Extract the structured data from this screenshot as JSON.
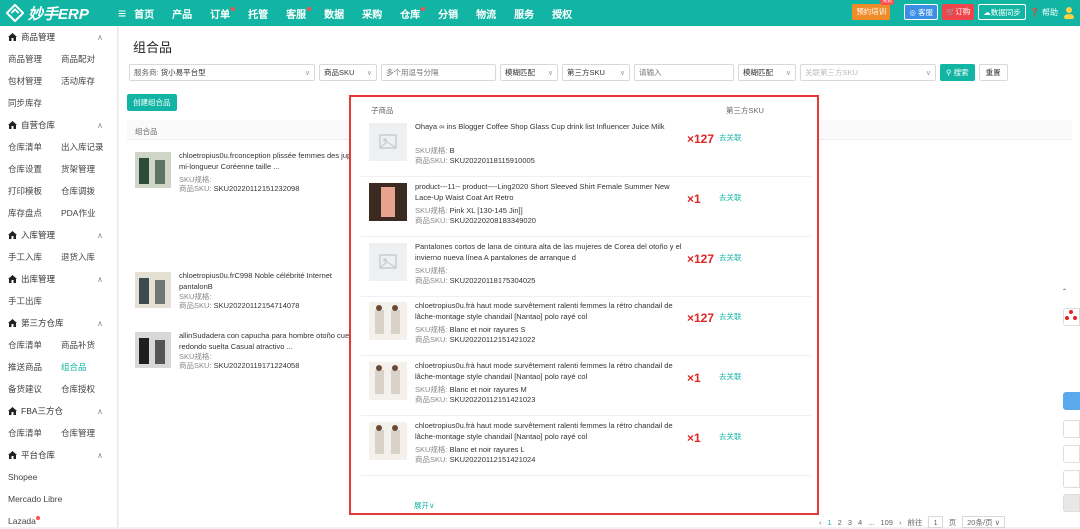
{
  "app": {
    "logo_text": "妙手ERP"
  },
  "topnav": {
    "items": [
      {
        "label": "首页",
        "dot": false
      },
      {
        "label": "产品",
        "dot": false
      },
      {
        "label": "订单",
        "dot": true
      },
      {
        "label": "托管",
        "dot": false
      },
      {
        "label": "客服",
        "dot": true
      },
      {
        "label": "数据",
        "dot": false
      },
      {
        "label": "采购",
        "dot": false
      },
      {
        "label": "仓库",
        "dot": true
      },
      {
        "label": "分销",
        "dot": false
      },
      {
        "label": "物流",
        "dot": false
      },
      {
        "label": "服务",
        "dot": false
      },
      {
        "label": "授权",
        "dot": false
      }
    ],
    "right": {
      "training": "预约培训",
      "training_badge": "免费",
      "service": "客服",
      "order": "订购",
      "sync": "数据同步",
      "help": "帮助"
    }
  },
  "sidebar": {
    "goods": {
      "title": "商品管理",
      "items": [
        "商品管理",
        "商品配对",
        "包材管理",
        "活动库存"
      ],
      "extra": "同步库存"
    },
    "self_wh": {
      "title": "自营仓库",
      "items": [
        "仓库清单",
        "出入库记录",
        "仓库设置",
        "货架管理",
        "打印模板",
        "仓库调拨",
        "库存盘点",
        "PDA作业"
      ]
    },
    "inbound": {
      "title": "入库管理",
      "items": [
        "手工入库",
        "退货入库"
      ]
    },
    "outbound": {
      "title": "出库管理",
      "items": [
        "手工出库"
      ]
    },
    "third_wh": {
      "title": "第三方仓库",
      "items": [
        "仓库清单",
        "商品补货",
        "推送商品",
        "组合品",
        "备货建议",
        "仓库授权"
      ]
    },
    "fba": {
      "title": "FBA三方仓",
      "items": [
        "仓库清单",
        "仓库管理"
      ]
    },
    "platform": {
      "title": "平台仓库",
      "items": [
        "Shopee",
        "Mercado Libre",
        "Lazada"
      ]
    }
  },
  "page": {
    "title": "组合品",
    "filter": {
      "service_label": "服务商:",
      "service_value": "货小易平台型",
      "sku_type": "商品SKU",
      "sku_placeholder": "多个用逗号分隔",
      "match1": "模糊匹配",
      "third_sku": "第三方SKU",
      "third_placeholder": "请输入",
      "match2": "模糊匹配",
      "link_placeholder": "关联第三方SKU",
      "search": "搜索",
      "reset": "重置"
    },
    "create_button": "创建组合品",
    "columns": {
      "combo": "组合品",
      "child": "子商品",
      "third_sku": "第三方SKU"
    },
    "combos": [
      {
        "title": "chloetropius0u.frconception plissée femmes des jupe mi-longueur Coréenne taille ...",
        "spec_label": "SKU规格:",
        "spec": "",
        "sku_label": "商品SKU:",
        "sku": "SKU20220112151232098"
      },
      {
        "title": "chloetropius0u.frC998 Noble célébrité Internet pantalonB",
        "spec_label": "SKU规格:",
        "spec": "",
        "sku_label": "商品SKU:",
        "sku": "SKU20220112154714078"
      },
      {
        "title": "allinSudadera con capucha para hombre otoño cuello redondo suelta Casual atractivo ...",
        "spec_label": "SKU规格:",
        "spec": "",
        "sku_label": "商品SKU:",
        "sku": "SKU20220119171224058"
      }
    ],
    "children": [
      {
        "title": "Ohaya ∞ ins Blogger Coffee Shop Glass Cup drink list Influencer Juice Milk",
        "spec_label": "SKU规格:",
        "spec": "B",
        "sku_label": "商品SKU:",
        "sku": "SKU20220118115910005",
        "qty": "×127",
        "link": "去关联"
      },
      {
        "title": "product---11-- product----Ling2020 Short Sleeved Shirt Female Summer New Lace-Up Waist Coat Art Retro",
        "spec_label": "SKU规格:",
        "spec": "Pink XL [130-145 Jin]]",
        "sku_label": "商品SKU:",
        "sku": "SKU20220208183349020",
        "qty": "×1",
        "link": "去关联"
      },
      {
        "title": "Pantalones cortos de lana de cintura alta de las mujeres de Corea del otoño y el invierno nueva línea A pantalones de arranque d",
        "spec_label": "SKU规格:",
        "spec": "",
        "sku_label": "商品SKU:",
        "sku": "SKU20220118175304025",
        "qty": "×127",
        "link": "去关联"
      },
      {
        "title": "chloetropius0u.frà haut mode survêtement ralenti femmes la rétro chandail de lâche-montage style chandail [Nantao] polo rayé col",
        "spec_label": "SKU规格:",
        "spec": "Blanc et noir rayures S",
        "sku_label": "商品SKU:",
        "sku": "SKU20220112151421022",
        "qty": "×127",
        "link": "去关联"
      },
      {
        "title": "chloetropius0u.frà haut mode survêtement ralenti femmes la rétro chandail de lâche-montage style chandail [Nantao] polo rayé col",
        "spec_label": "SKU规格:",
        "spec": "Blanc et noir rayures M",
        "sku_label": "商品SKU:",
        "sku": "SKU20220112151421023",
        "qty": "×1",
        "link": "去关联"
      },
      {
        "title": "chloetropius0u.frà haut mode survêtement ralenti femmes la rétro chandail de lâche-montage style chandail [Nantao] polo rayé col",
        "spec_label": "SKU规格:",
        "spec": "Blanc et noir rayures L",
        "sku_label": "商品SKU:",
        "sku": "SKU20220112151421024",
        "qty": "×1",
        "link": "去关联"
      }
    ],
    "expand": "展开",
    "pager": {
      "pages": [
        "1",
        "2",
        "3",
        "4",
        "...",
        "109"
      ],
      "goto_label": "前往",
      "goto_value": "1",
      "page_unit": "页",
      "size": "20条/页"
    }
  }
}
